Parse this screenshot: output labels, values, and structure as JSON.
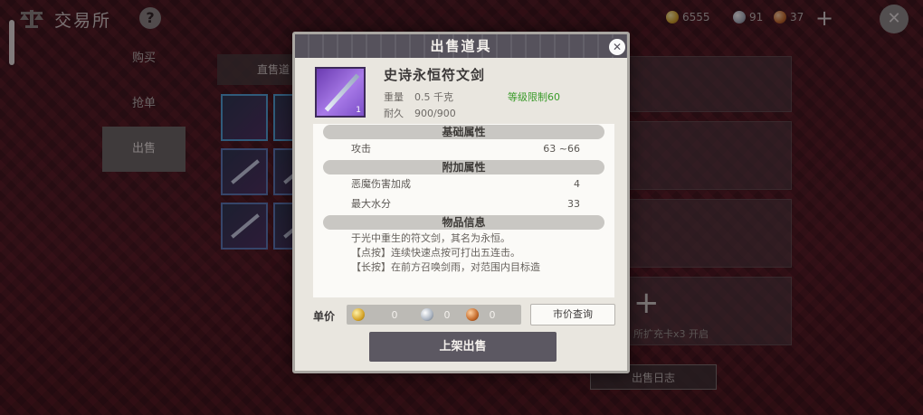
{
  "header": {
    "title": "交易所",
    "help_icon": "?",
    "currency": [
      {
        "type": "gold",
        "amount": "6555"
      },
      {
        "type": "silver",
        "amount": "91"
      },
      {
        "type": "bronze",
        "amount": "37"
      }
    ],
    "add_icon": "+",
    "close_icon": "✕"
  },
  "sidebar": {
    "items": [
      {
        "label": "购买"
      },
      {
        "label": "抢单"
      },
      {
        "label": "出售"
      }
    ],
    "active": "出售"
  },
  "main": {
    "panel_header": "直售道",
    "expand_slot_text": "所扩充卡x3 开启",
    "sell_log_button": "出售日志"
  },
  "modal": {
    "title": "出售道具",
    "item": {
      "name": "史诗永恒符文剑",
      "level_badge": "1",
      "weight_label": "重量",
      "weight_value": "0.5 千克",
      "durability_label": "耐久",
      "durability_value": "900/900",
      "level_requirement": "等级限制60"
    },
    "sections": {
      "base": "基础属性",
      "bonus": "附加属性",
      "info": "物品信息"
    },
    "base_stats": [
      {
        "name": "攻击",
        "value": "63 ~66"
      }
    ],
    "bonus_stats": [
      {
        "name": "恶魔伤害加成",
        "value": "4"
      },
      {
        "name": "最大水分",
        "value": "33"
      }
    ],
    "description": [
      "于光中重生的符文剑，其名为永恒。",
      "【点按】连续快速点按可打出五连击。",
      "【长按】在前方召唤剑雨，对范围内目标造"
    ],
    "price": {
      "label": "单价",
      "gold": "0",
      "silver": "0",
      "bronze": "0"
    },
    "market_query_button": "市价查询",
    "list_button": "上架出售"
  },
  "colors": {
    "modal_header": "#56525c",
    "level_requirement": "#3a9b2a",
    "panel_bg": "#e9e6df"
  }
}
